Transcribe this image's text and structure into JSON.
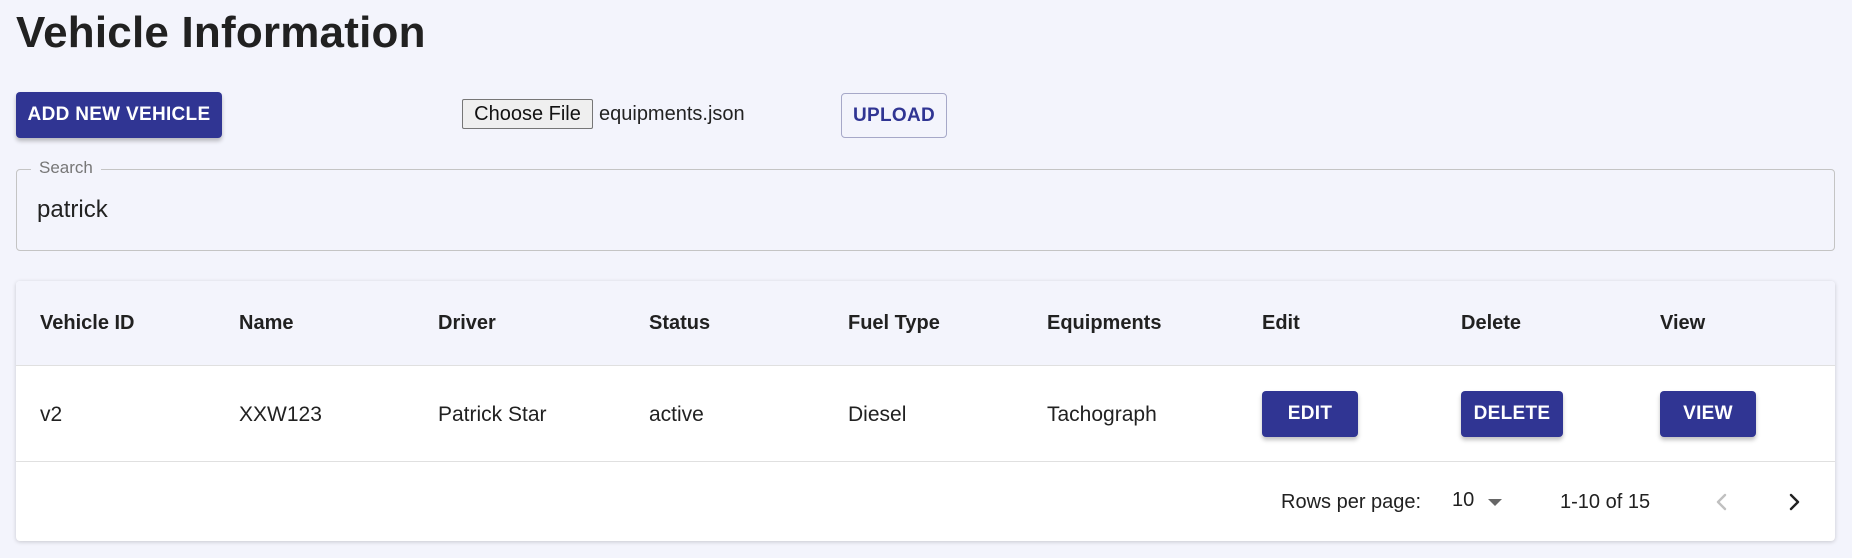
{
  "page": {
    "title": "Vehicle Information"
  },
  "toolbar": {
    "add_label": "ADD NEW VEHICLE",
    "choose_file_label": "Choose File",
    "file_name": "equipments.json",
    "upload_label": "UPLOAD"
  },
  "search": {
    "label": "Search",
    "value": "patrick"
  },
  "table": {
    "columns": [
      "Vehicle ID",
      "Name",
      "Driver",
      "Status",
      "Fuel Type",
      "Equipments",
      "Edit",
      "Delete",
      "View"
    ],
    "rows": [
      {
        "vehicle_id": "v2",
        "name": "XXW123",
        "driver": "Patrick Star",
        "status": "active",
        "fuel_type": "Diesel",
        "equipments": "Tachograph",
        "edit_label": "EDIT",
        "delete_label": "DELETE",
        "view_label": "VIEW"
      }
    ]
  },
  "pagination": {
    "rows_per_page_label": "Rows per page:",
    "rows_per_page_value": "10",
    "range_text": "1-10 of 15",
    "prev_icon": "chevron-left-icon",
    "next_icon": "chevron-right-icon"
  },
  "colors": {
    "primary": "#303593",
    "background": "#f3f4fc",
    "text": "#212121"
  }
}
